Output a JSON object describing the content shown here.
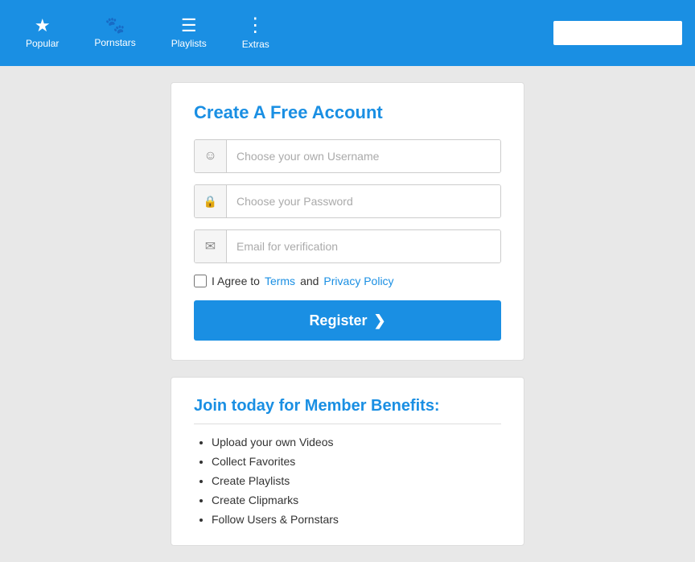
{
  "navbar": {
    "items": [
      {
        "id": "popular",
        "label": "Popular",
        "icon": "★"
      },
      {
        "id": "pornstars",
        "label": "Pornstars",
        "icon": "♟"
      },
      {
        "id": "playlists",
        "label": "Playlists",
        "icon": "☰"
      },
      {
        "id": "extras",
        "label": "Extras",
        "icon": "⋮"
      }
    ],
    "search_placeholder": ""
  },
  "register_card": {
    "title": "Create A Free Account",
    "username_placeholder": "Choose your own Username",
    "password_placeholder": "Choose your Password",
    "email_placeholder": "Email for verification",
    "agree_text": "I Agree to",
    "terms_label": "Terms",
    "and_text": "and",
    "privacy_label": "Privacy Policy",
    "register_label": "Register",
    "register_arrow": "❯"
  },
  "benefits_card": {
    "title": "Join today for Member Benefits:",
    "items": [
      "Upload your own Videos",
      "Collect Favorites",
      "Create Playlists",
      "Create Clipmarks",
      "Follow Users & Pornstars"
    ]
  }
}
